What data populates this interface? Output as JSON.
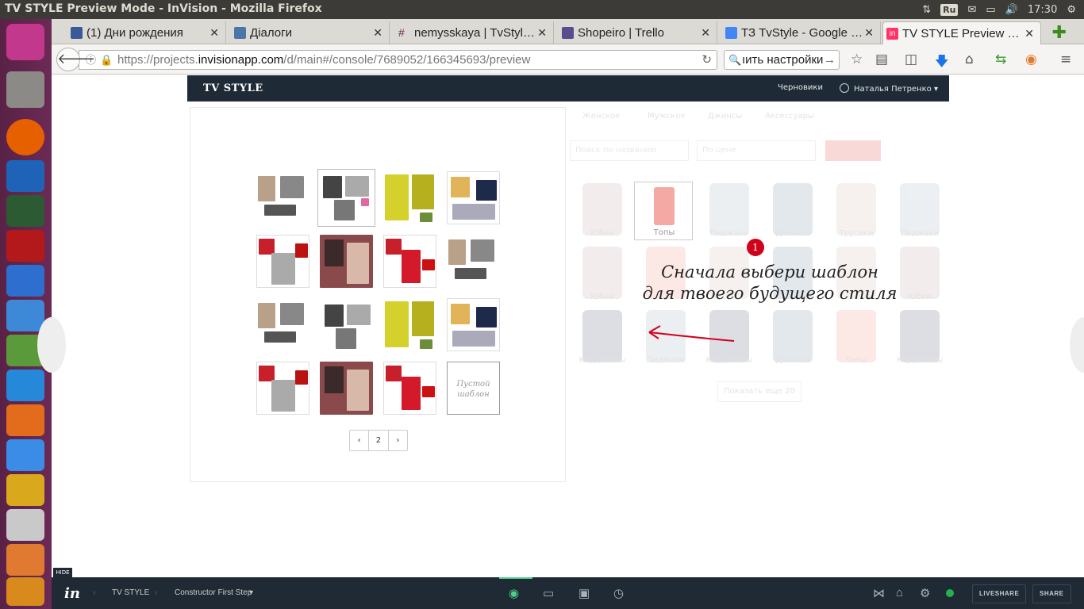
{
  "window_title": "TV STYLE Preview Mode - InVision - Mozilla Firefox",
  "tray": {
    "keyboard": "Ru",
    "time": "17:30"
  },
  "tabs": [
    {
      "label": "(1) Дни рождения",
      "favicon_color": "#3b5998"
    },
    {
      "label": "Діалоги",
      "favicon_color": "#4a76a8"
    },
    {
      "label": "nemysskaya | TvStyl…",
      "favicon_color": "#ffffff"
    },
    {
      "label": "Shopeiro | Trello",
      "favicon_color": "#0079bf"
    },
    {
      "label": "ТЗ TvStyle - Google …",
      "favicon_color": "#4285f4"
    },
    {
      "label": "TV STYLE Preview …",
      "favicon_color": "#ff3366"
    }
  ],
  "url": {
    "prefix": "https://projects.",
    "domain": "invisionapp.com",
    "path": "/d/main#/console/7689052/166345693/preview"
  },
  "search": {
    "value": "ıить настройки"
  },
  "app": {
    "logo": "TV STYLE",
    "drafts": "Черновики",
    "user": "Наталья Петренко"
  },
  "templates": {
    "empty_label": "Пустой шаблон",
    "page_number": "2"
  },
  "catalog": {
    "tabs": [
      "Женское",
      "Мужское",
      "Джинсы",
      "Аксессуары"
    ],
    "search_placeholder": "Поиск по названию",
    "price_placeholder": "По цене",
    "rows": [
      [
        "Юбки",
        "Топы",
        "Пиджаки",
        "Джинсы",
        "Трусики",
        "Пиджаки"
      ],
      [
        "Юбки",
        "",
        "",
        "",
        "",
        "Юбки"
      ],
      [
        "Кардиганы",
        "Пиджаки",
        "Кардиганы",
        "Джинсы",
        "Топы",
        "Кардиганы"
      ]
    ],
    "show_more": "Показать еще 20"
  },
  "callout": {
    "badge": "1",
    "line1": "Сначала выбери шаблон",
    "line2": "для твоего будущего стиля"
  },
  "invision_bar": {
    "hide": "HIDE",
    "project": "TV STYLE",
    "screen": "Constructor First Step",
    "liveshare": "LIVESHARE",
    "share": "SHARE"
  }
}
